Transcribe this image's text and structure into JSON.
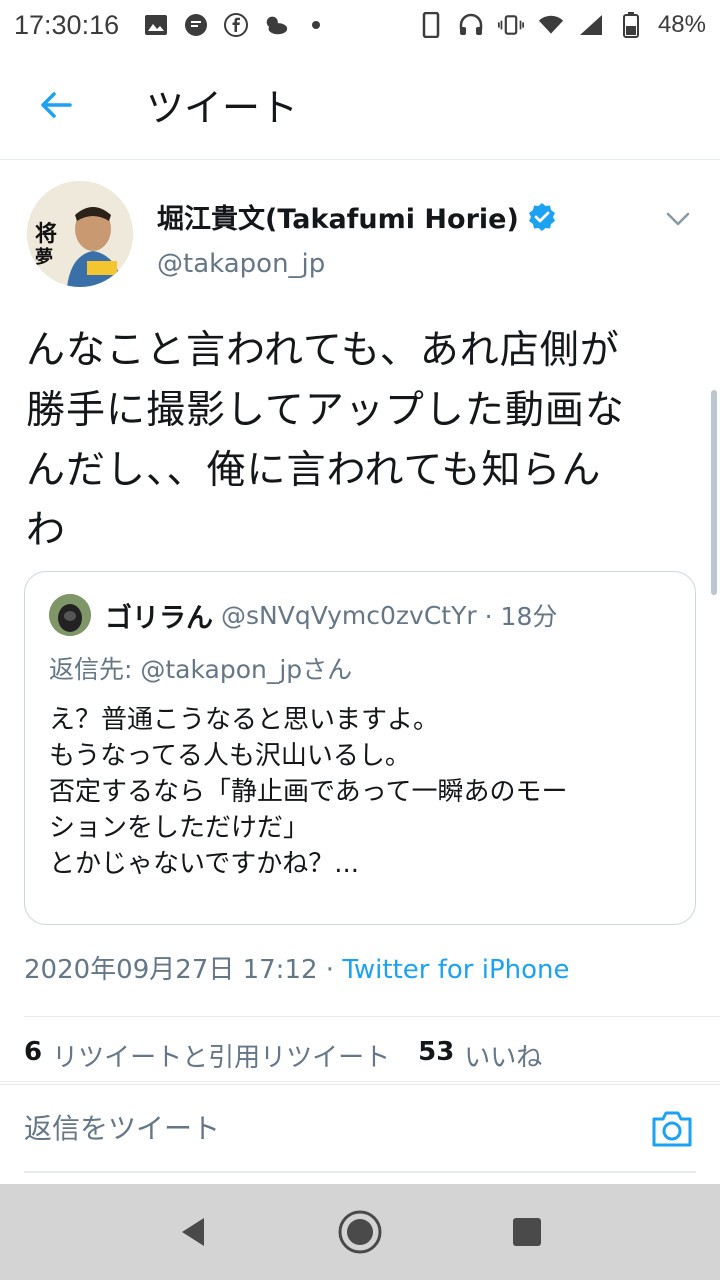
{
  "status_bar": {
    "time": "17:30:16",
    "battery": "48%"
  },
  "app_bar": {
    "title": "ツイート"
  },
  "tweet": {
    "author_name": "堀江貴文(Takafumi Horie)",
    "author_handle": "@takapon_jp",
    "text_lines": [
      "んなこと言われても、あれ店側が",
      "勝手に撮影してアップした動画な",
      "んだし、、俺に言われても知らん",
      "わ"
    ],
    "timestamp": "2020年09月27日 17:12",
    "separator": "·",
    "source": "Twitter for iPhone",
    "retweet_count": "6",
    "retweet_label": "リツイートと引用リツイート",
    "like_count": "53",
    "like_label": "いいね"
  },
  "quote": {
    "name": "ゴリラん",
    "handle": "@sNVqVymc0zvCtYr",
    "time": "· 18分",
    "reply_to": "返信先: @takapon_jpさん",
    "lines": [
      "え？普通こうなると思いますよ。",
      "もうなってる人も沢山いるし。",
      "否定するなら「静止画であって一瞬あのモー",
      "ションをしただけだ」",
      "とかじゃないですかね？..."
    ]
  },
  "reply_bar": {
    "placeholder": "返信をツイート"
  },
  "colors": {
    "accent": "#1da1f2",
    "secondary_text": "#657786",
    "primary_text": "#14171a",
    "divider": "#e6ecf0",
    "nav_bar": "#d4d4d4"
  }
}
